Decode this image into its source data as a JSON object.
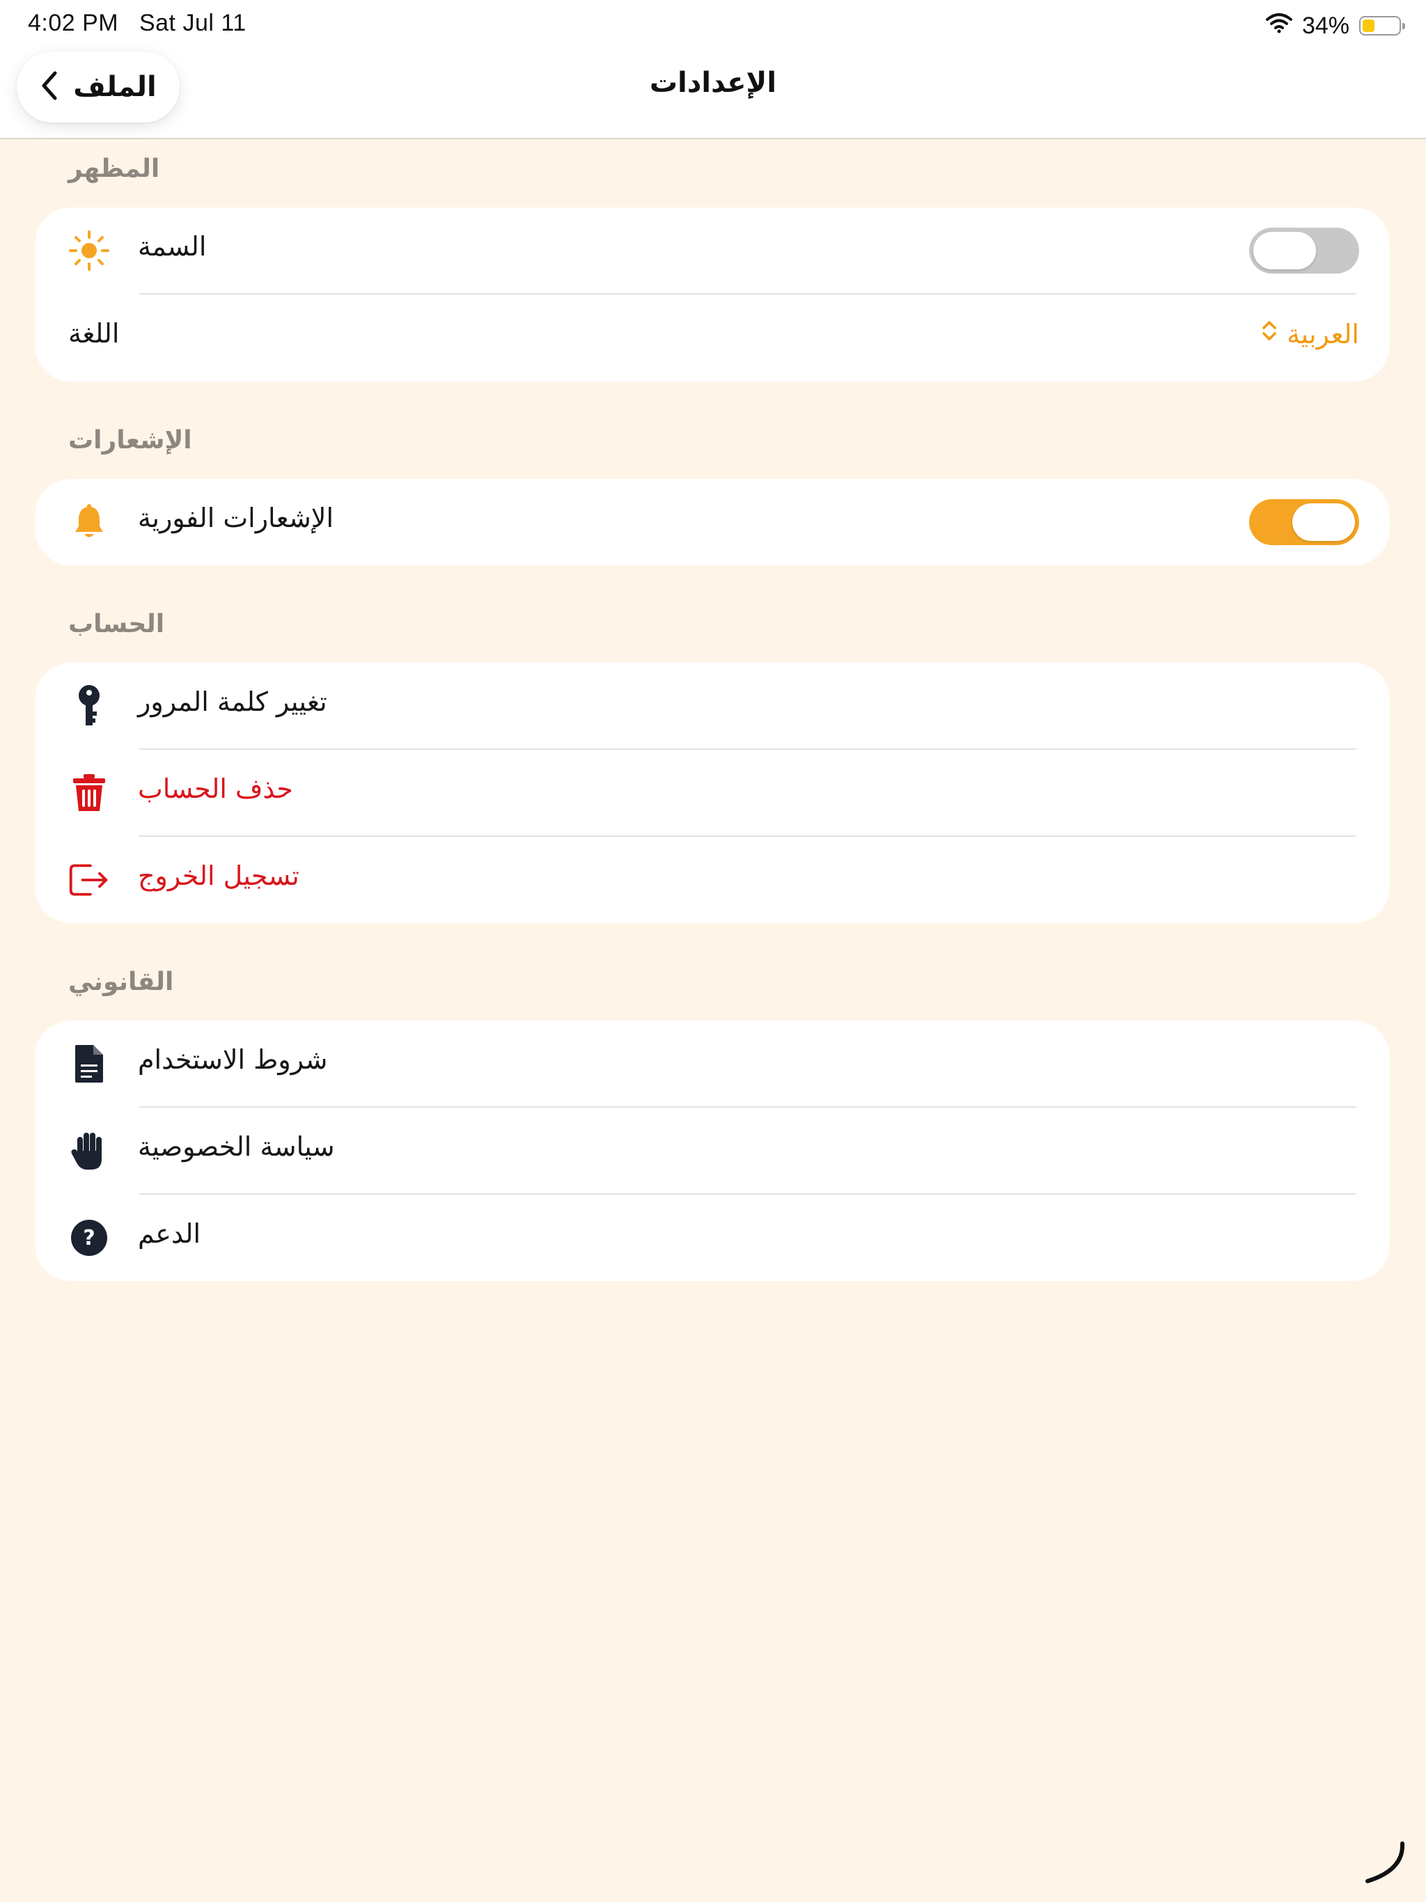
{
  "status_bar": {
    "time": "4:02 PM",
    "date": "Sat Jul 11",
    "battery_percent": "34%",
    "battery_level": 0.34
  },
  "nav": {
    "back_label": "الملف",
    "title": "الإعدادات"
  },
  "sections": {
    "appearance": {
      "header": "المظهر",
      "theme_label": "السمة",
      "theme_dark_enabled": false,
      "language_label": "اللغة",
      "language_value": "العربية"
    },
    "notifications": {
      "header": "الإشعارات",
      "push_label": "الإشعارات الفورية",
      "push_enabled": true
    },
    "account": {
      "header": "الحساب",
      "change_password": "تغيير كلمة المرور",
      "delete_account": "حذف الحساب",
      "logout": "تسجيل الخروج"
    },
    "legal": {
      "header": "القانوني",
      "terms": "شروط الاستخدام",
      "privacy": "سياسة الخصوصية",
      "support": "الدعم"
    }
  },
  "colors": {
    "accent": "#F5A523",
    "danger": "#D9151B",
    "background": "#FEF5E8",
    "card": "#FFFFFF",
    "section_header": "#8C8780"
  },
  "icons": {
    "theme": "sun-icon",
    "notifications": "bell-icon",
    "password": "key-icon",
    "delete": "trash-icon",
    "logout": "logout-icon",
    "terms": "document-icon",
    "privacy": "hand-icon",
    "support": "help-icon"
  }
}
